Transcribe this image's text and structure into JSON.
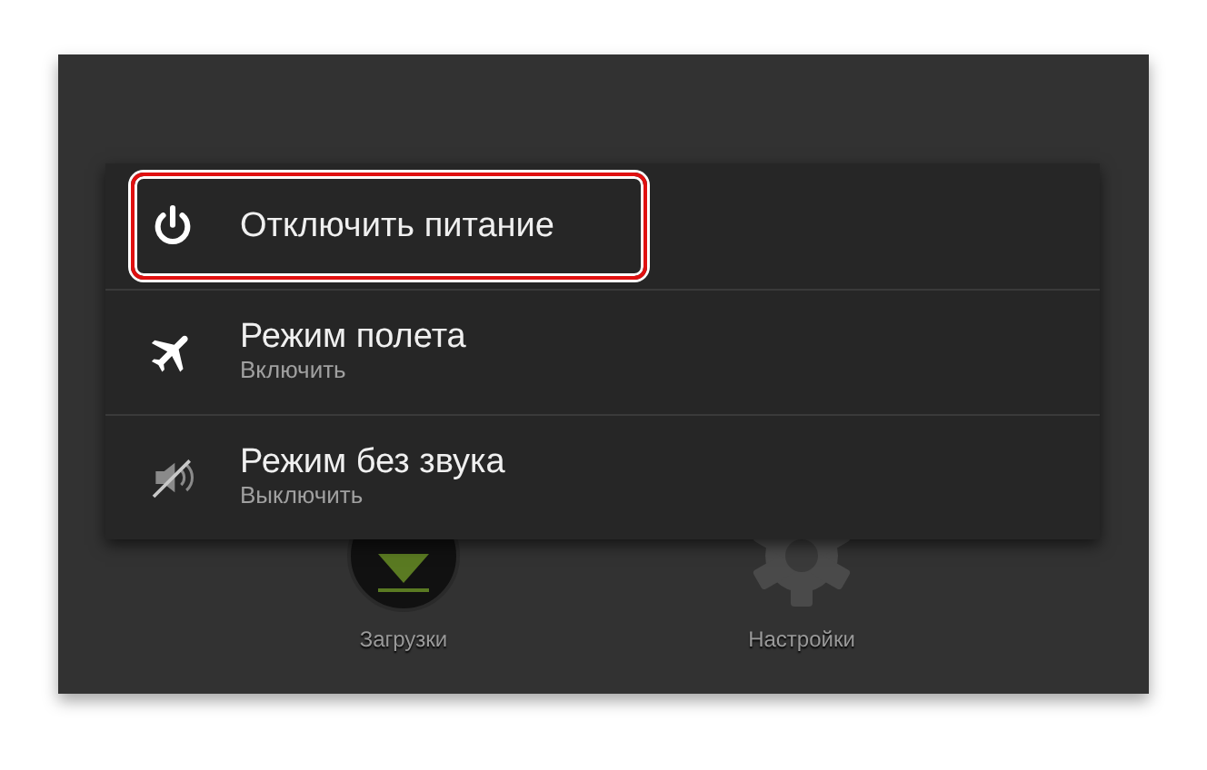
{
  "home_apps": [
    {
      "label": "Загрузки",
      "kind": "download"
    },
    {
      "label": "Настройки",
      "kind": "settings"
    }
  ],
  "menu": {
    "items": [
      {
        "kind": "power",
        "title": "Отключить питание",
        "highlighted": true
      },
      {
        "kind": "airplane",
        "title": "Режим полета",
        "subtitle": "Включить",
        "highlighted": false
      },
      {
        "kind": "mute",
        "title": "Режим без звука",
        "subtitle": "Выключить",
        "highlighted": false
      }
    ]
  }
}
